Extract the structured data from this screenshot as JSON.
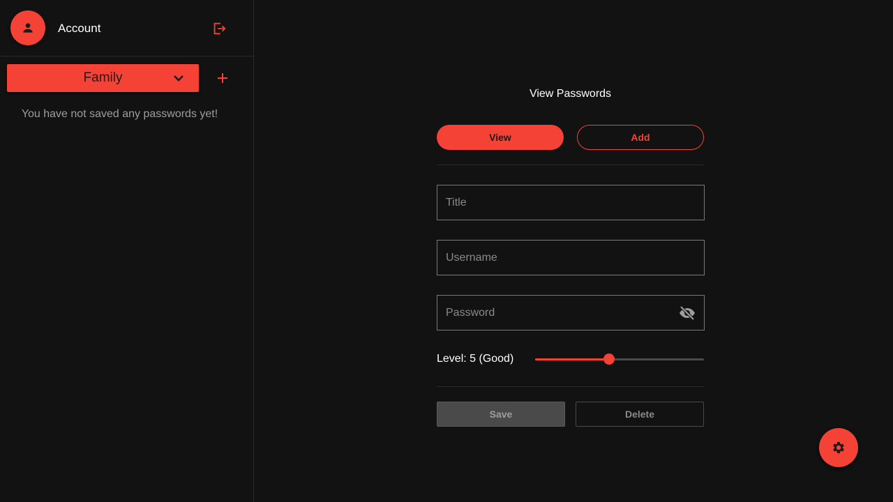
{
  "sidebar": {
    "account_label": "Account",
    "vault_selected": "Family",
    "empty_message": "You have not saved any passwords yet!",
    "icons": {
      "avatar": "person-icon",
      "logout": "logout-icon",
      "vault_dropdown": "chevron-down-icon",
      "add_vault": "plus-icon"
    }
  },
  "main": {
    "title": "View Passwords",
    "tabs": [
      {
        "label": "View",
        "active": true
      },
      {
        "label": "Add",
        "active": false
      }
    ],
    "fields": {
      "title_placeholder": "Title",
      "username_placeholder": "Username",
      "password_placeholder": "Password",
      "title_value": "",
      "username_value": "",
      "password_value": ""
    },
    "level": {
      "label": "Level: 5 (Good)",
      "value_fraction": 0.44
    },
    "actions": {
      "save_label": "Save",
      "delete_label": "Delete"
    }
  },
  "fab": {
    "icon": "gear-icon"
  },
  "colors": {
    "accent": "#f44336",
    "background": "#121212",
    "border": "#2a2a2a"
  }
}
